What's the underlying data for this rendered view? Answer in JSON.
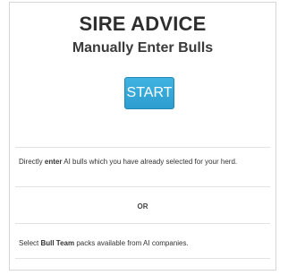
{
  "header": {
    "title": "SIRE ADVICE",
    "subtitle": "Manually Enter Bulls"
  },
  "start_button": {
    "label": "START",
    "color": "#35a8d9"
  },
  "option_direct": {
    "lead": "Directly ",
    "emphasis": "enter",
    "rest": " AI bulls which you have already selected for your herd."
  },
  "separator": {
    "label": "OR"
  },
  "option_packs": {
    "lead": "Select ",
    "emphasis": "Bull Team",
    "rest": " packs available from AI companies."
  }
}
